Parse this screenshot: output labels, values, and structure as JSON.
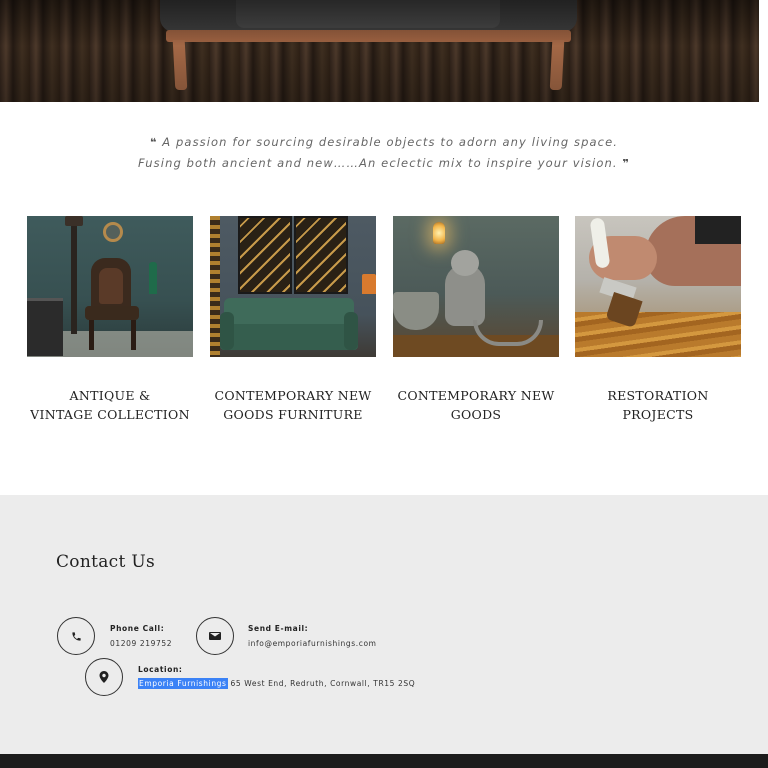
{
  "quote": {
    "line1": "A passion for sourcing desirable objects to adorn any living space.",
    "line2": "Fusing both ancient and new……An eclectic mix to inspire your vision.",
    "open_mark": "❝",
    "close_mark": "❞"
  },
  "categories": [
    {
      "line1": "ANTIQUE &",
      "line2": "VINTAGE COLLECTION",
      "image": "antique-chair-room"
    },
    {
      "line1": "CONTEMPORARY NEW",
      "line2": "GOODS FURNITURE",
      "image": "green-velvet-sofa"
    },
    {
      "line1": "CONTEMPORARY NEW",
      "line2": "GOODS",
      "image": "monkey-lamp"
    },
    {
      "line1": "RESTORATION",
      "line2": "PROJECTS",
      "image": "paintbrush-varnish"
    }
  ],
  "contact": {
    "title": "Contact Us",
    "phone": {
      "label": "Phone Call:",
      "value": "01209 219752",
      "icon": "phone-icon"
    },
    "email": {
      "label": "Send E-mail:",
      "value": "info@emporiafurnishings.com",
      "icon": "envelope-icon"
    },
    "location": {
      "label": "Location:",
      "highlighted": "Emporia Furnishings",
      "address": " 65 West End, Redruth, Cornwall, TR15 2SQ",
      "icon": "map-pin-icon"
    }
  },
  "colors": {
    "contact_bg": "#ececec",
    "footer_bg": "#1c1c1c",
    "selection": "#3b82f6"
  }
}
